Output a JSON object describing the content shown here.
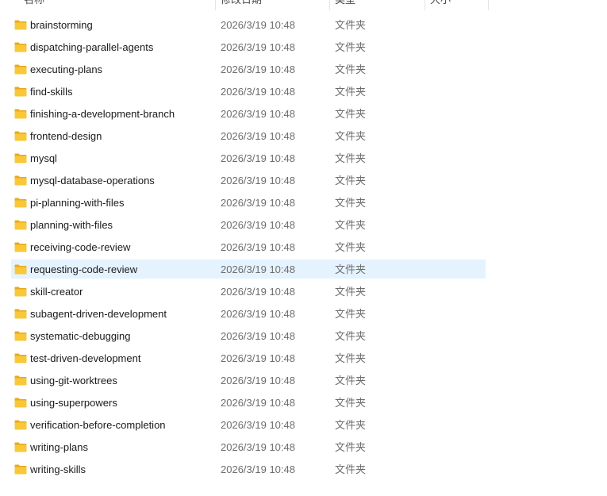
{
  "columns": {
    "name": "名称",
    "modified": "修改日期",
    "type": "类型",
    "size": "大小"
  },
  "selected_index": 11,
  "files": [
    {
      "name": "brainstorming",
      "modified": "2026/3/19 10:48",
      "type": "文件夹",
      "icon": "folder-icon"
    },
    {
      "name": "dispatching-parallel-agents",
      "modified": "2026/3/19 10:48",
      "type": "文件夹",
      "icon": "folder-icon"
    },
    {
      "name": "executing-plans",
      "modified": "2026/3/19 10:48",
      "type": "文件夹",
      "icon": "folder-icon"
    },
    {
      "name": "find-skills",
      "modified": "2026/3/19 10:48",
      "type": "文件夹",
      "icon": "folder-icon"
    },
    {
      "name": "finishing-a-development-branch",
      "modified": "2026/3/19 10:48",
      "type": "文件夹",
      "icon": "folder-icon"
    },
    {
      "name": "frontend-design",
      "modified": "2026/3/19 10:48",
      "type": "文件夹",
      "icon": "folder-icon"
    },
    {
      "name": "mysql",
      "modified": "2026/3/19 10:48",
      "type": "文件夹",
      "icon": "folder-icon"
    },
    {
      "name": "mysql-database-operations",
      "modified": "2026/3/19 10:48",
      "type": "文件夹",
      "icon": "folder-icon"
    },
    {
      "name": "pi-planning-with-files",
      "modified": "2026/3/19 10:48",
      "type": "文件夹",
      "icon": "folder-icon"
    },
    {
      "name": "planning-with-files",
      "modified": "2026/3/19 10:48",
      "type": "文件夹",
      "icon": "folder-icon"
    },
    {
      "name": "receiving-code-review",
      "modified": "2026/3/19 10:48",
      "type": "文件夹",
      "icon": "folder-icon"
    },
    {
      "name": "requesting-code-review",
      "modified": "2026/3/19 10:48",
      "type": "文件夹",
      "icon": "folder-icon"
    },
    {
      "name": "skill-creator",
      "modified": "2026/3/19 10:48",
      "type": "文件夹",
      "icon": "folder-icon"
    },
    {
      "name": "subagent-driven-development",
      "modified": "2026/3/19 10:48",
      "type": "文件夹",
      "icon": "folder-icon"
    },
    {
      "name": "systematic-debugging",
      "modified": "2026/3/19 10:48",
      "type": "文件夹",
      "icon": "folder-icon"
    },
    {
      "name": "test-driven-development",
      "modified": "2026/3/19 10:48",
      "type": "文件夹",
      "icon": "folder-icon"
    },
    {
      "name": "using-git-worktrees",
      "modified": "2026/3/19 10:48",
      "type": "文件夹",
      "icon": "folder-icon"
    },
    {
      "name": "using-superpowers",
      "modified": "2026/3/19 10:48",
      "type": "文件夹",
      "icon": "folder-icon"
    },
    {
      "name": "verification-before-completion",
      "modified": "2026/3/19 10:48",
      "type": "文件夹",
      "icon": "folder-icon"
    },
    {
      "name": "writing-plans",
      "modified": "2026/3/19 10:48",
      "type": "文件夹",
      "icon": "folder-icon"
    },
    {
      "name": "writing-skills",
      "modified": "2026/3/19 10:48",
      "type": "文件夹",
      "icon": "folder-icon"
    }
  ],
  "colors": {
    "selection": "#e5f3ff",
    "folder_body": "#f8c83a",
    "folder_tab": "#e9a920",
    "name_text": "#1a1a1a",
    "meta_text": "#6d6d6d"
  }
}
